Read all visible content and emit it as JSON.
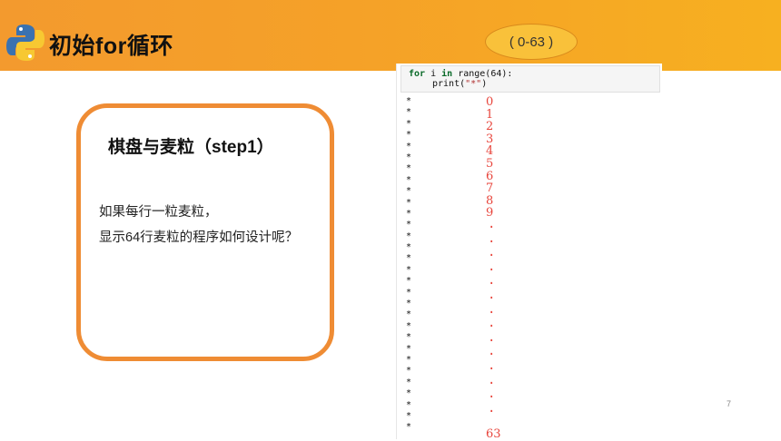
{
  "header": {
    "title": "初始for循环",
    "logo_icon": "python-logo-icon",
    "color": "#f5a128"
  },
  "bubble": {
    "text": "( 0-63 )"
  },
  "card": {
    "title": "棋盘与麦粒（step1）",
    "lines": [
      "如果每行一粒麦粒，",
      "显示64行麦粒的程序如何设计呢？"
    ],
    "border_color": "#ef8c34"
  },
  "code": {
    "keyword_for": "for",
    "var": " i ",
    "keyword_in": "in",
    "range_call": " range(64):",
    "print_call": "print(",
    "print_arg": "\"*\"",
    "print_close": ")"
  },
  "output": {
    "star": "*",
    "first_numbers": [
      "0",
      "1",
      "2",
      "3",
      "4",
      "5",
      "6",
      "7",
      "8",
      "9"
    ],
    "ellipsis_dot": ".",
    "last_number": "63"
  },
  "page_number": "7"
}
